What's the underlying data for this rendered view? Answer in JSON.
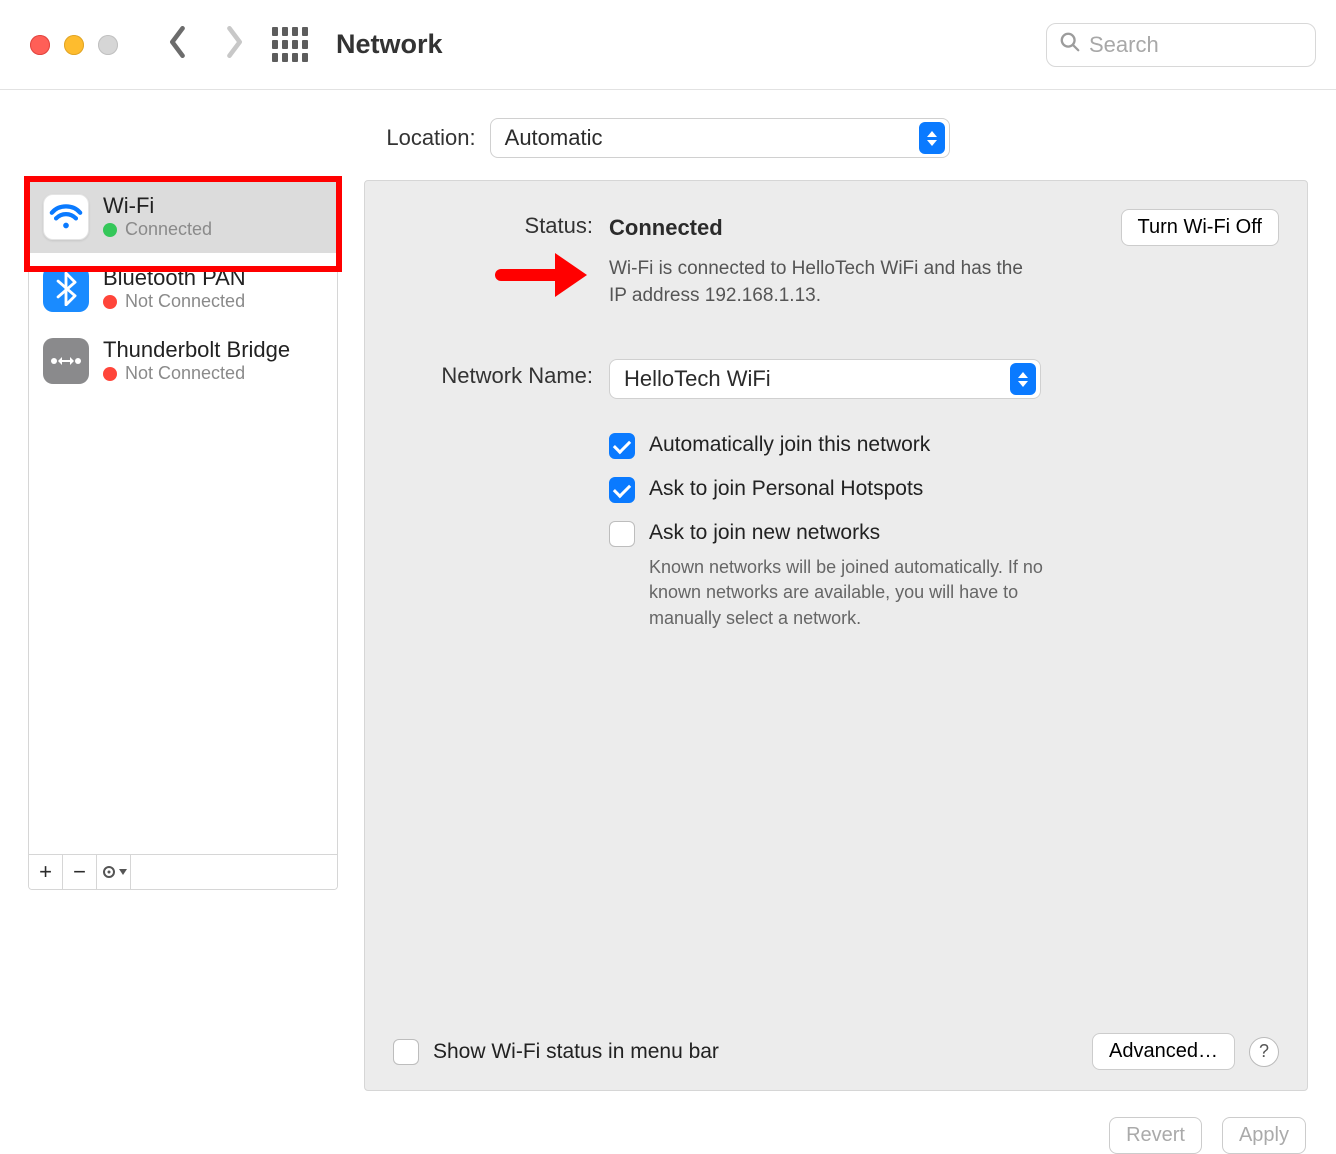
{
  "title": "Network",
  "search_placeholder": "Search",
  "location_label": "Location:",
  "location_value": "Automatic",
  "sidebar": {
    "services": [
      {
        "name": "Wi-Fi",
        "status": "Connected",
        "dot": "green",
        "icon": "wifi",
        "selected": true
      },
      {
        "name": "Bluetooth PAN",
        "status": "Not Connected",
        "dot": "red",
        "icon": "bt",
        "selected": false
      },
      {
        "name": "Thunderbolt Bridge",
        "status": "Not Connected",
        "dot": "red",
        "icon": "tb",
        "selected": false
      }
    ]
  },
  "details": {
    "status_label": "Status:",
    "status_value": "Connected",
    "toggle_button": "Turn Wi-Fi Off",
    "status_description": "Wi-Fi is connected to HelloTech WiFi and has the IP address 192.168.1.13.",
    "network_name_label": "Network Name:",
    "network_name_value": "HelloTech WiFi",
    "checkboxes": {
      "auto_join": {
        "label": "Automatically join this network",
        "checked": true
      },
      "ask_hotspots": {
        "label": "Ask to join Personal Hotspots",
        "checked": true
      },
      "ask_new": {
        "label": "Ask to join new networks",
        "checked": false,
        "description": "Known networks will be joined automatically. If no known networks are available, you will have to manually select a network."
      }
    },
    "show_in_menubar": {
      "label": "Show Wi-Fi status in menu bar",
      "checked": false
    },
    "advanced_button": "Advanced…"
  },
  "footer": {
    "revert": "Revert",
    "apply": "Apply"
  }
}
